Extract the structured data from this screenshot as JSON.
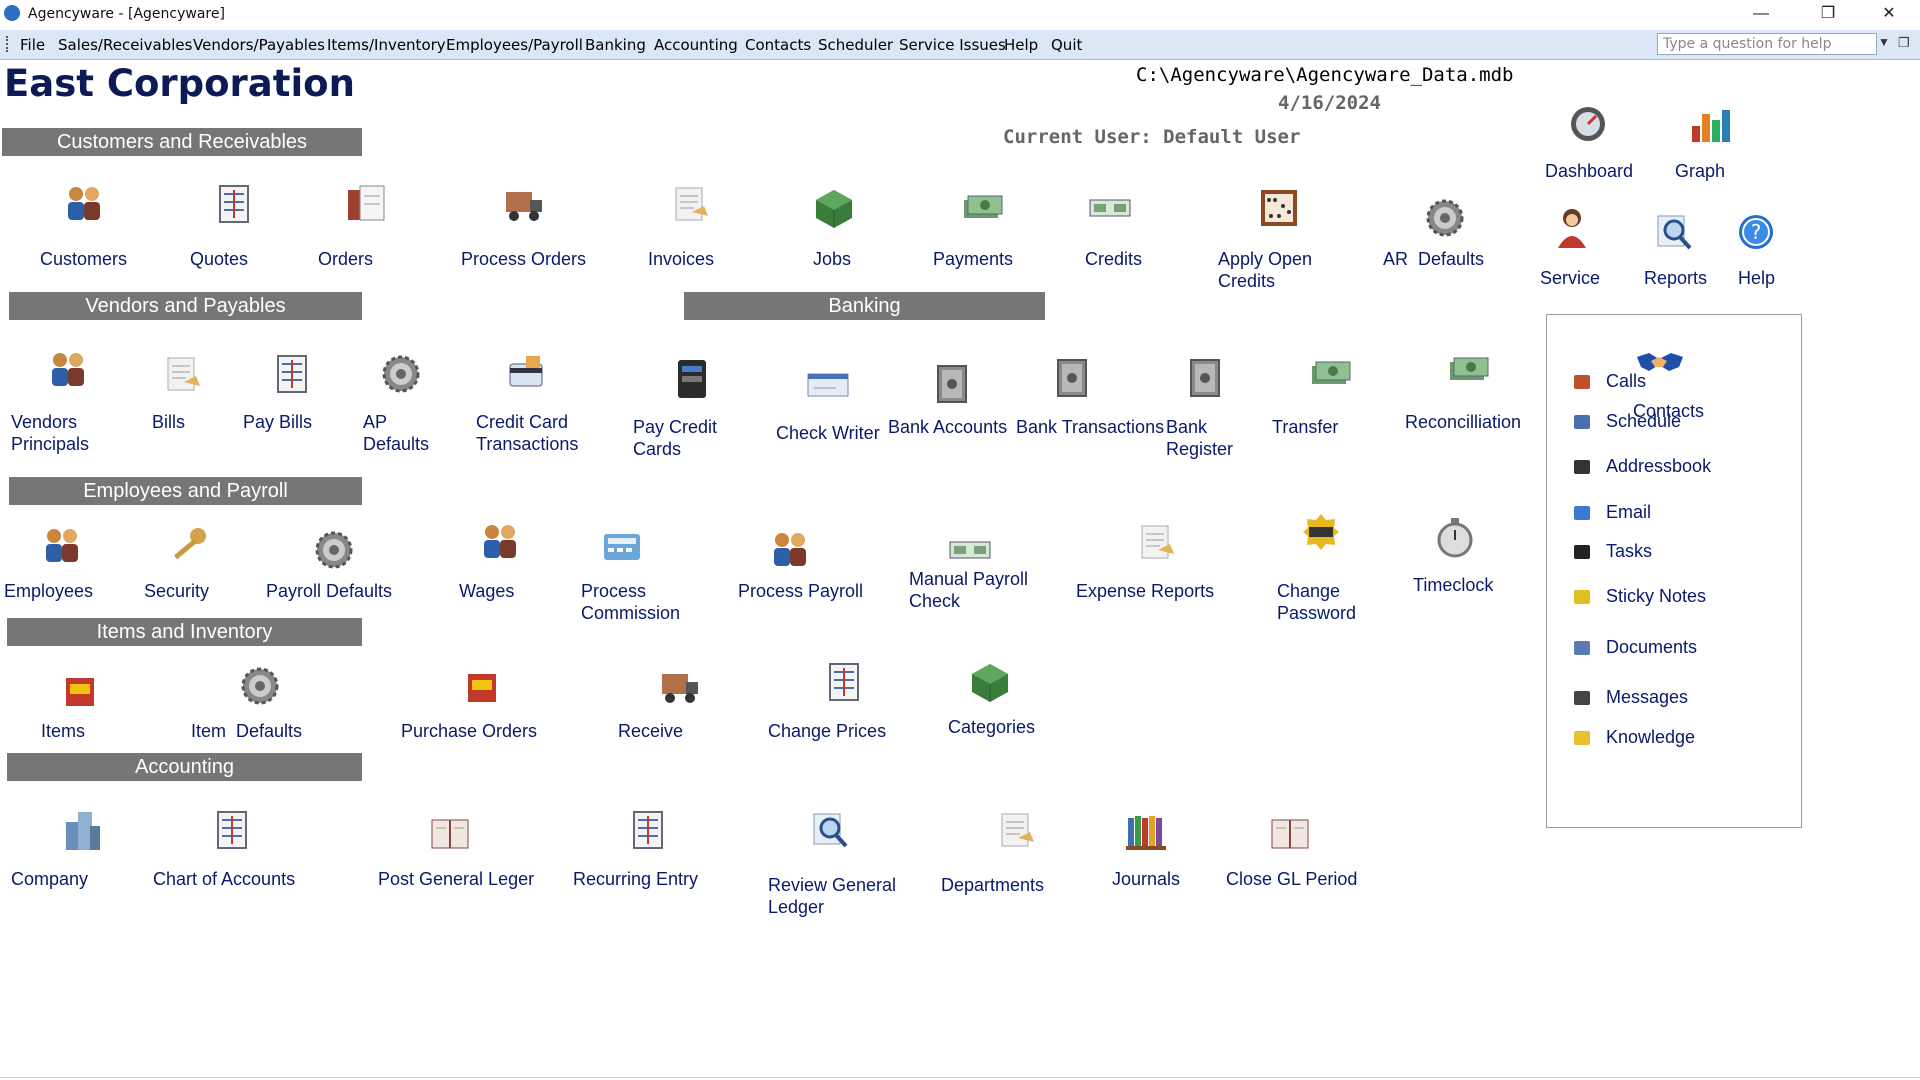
{
  "window": {
    "title": "Agencyware - [Agencyware]",
    "controls": [
      "—",
      "❐",
      "✕"
    ]
  },
  "menubar": {
    "items": [
      "File",
      "Sales/Receivables",
      "Vendors/Payables",
      "Items/Inventory",
      "Employees/Payroll",
      "Banking",
      "Accounting",
      "Contacts",
      "Scheduler",
      "Service Issues",
      "Help",
      "Quit"
    ],
    "help_placeholder": "Type a question for help"
  },
  "header": {
    "company": "East Corporation",
    "db_path": "C:\\Agencyware\\Agencyware_Data.mdb",
    "date": "4/16/2024",
    "current_user": "Current User: Default User"
  },
  "sections": {
    "customers": "Customers and Receivables",
    "vendors": "Vendors and Payables",
    "banking": "Banking",
    "employees": "Employees and Payroll",
    "items": "Items and Inventory",
    "accounting": "Accounting"
  },
  "tiles": {
    "customers": "Customers",
    "quotes": "Quotes",
    "orders": "Orders",
    "process_orders": "Process Orders",
    "invoices": "Invoices",
    "jobs": "Jobs",
    "payments": "Payments",
    "credits": "Credits",
    "apply_open_credits": "Apply Open\nCredits",
    "ar_defaults": "AR  Defaults",
    "vendors_principals": "Vendors\nPrincipals",
    "bills": "Bills",
    "pay_bills": "Pay Bills",
    "ap_defaults": "AP\nDefaults",
    "credit_card_transactions": "Credit Card\nTransactions",
    "pay_credit_cards": "Pay Credit\nCards",
    "check_writer": "Check Writer",
    "bank_accounts": "Bank Accounts",
    "bank_transactions": "Bank Transactions",
    "bank_register": "Bank\nRegister",
    "transfer": "Transfer",
    "reconcilliation": "Reconcilliation",
    "employees": "Employees",
    "security": "Security",
    "payroll_defaults": "Payroll Defaults",
    "wages": "Wages",
    "process_commission": "Process\nCommission",
    "process_payroll": "Process Payroll",
    "manual_payroll_check": "Manual Payroll\nCheck",
    "expense_reports": "Expense Reports",
    "change_password": "Change\nPassword",
    "timeclock": "Timeclock",
    "items": "Items",
    "item_defaults": "Item  Defaults",
    "purchase_orders": "Purchase Orders",
    "receive": "Receive",
    "change_prices": "Change Prices",
    "categories": "Categories",
    "company": "Company",
    "chart_of_accounts": "Chart of Accounts",
    "post_general_leger": "Post General Leger",
    "recurring_entry": "Recurring Entry",
    "review_general_ledger": "Review General\nLedger",
    "departments": "Departments",
    "journals": "Journals",
    "close_gl_period": "Close GL Period",
    "dashboard": "Dashboard",
    "graph": "Graph",
    "service": "Service",
    "reports": "Reports",
    "help": "Help"
  },
  "contacts_panel": {
    "title": "Contacts",
    "items": [
      "Calls",
      "Schedule",
      "Addressbook",
      "Email",
      "Tasks",
      "Sticky Notes",
      "Documents",
      "Messages",
      "Knowledge"
    ]
  }
}
